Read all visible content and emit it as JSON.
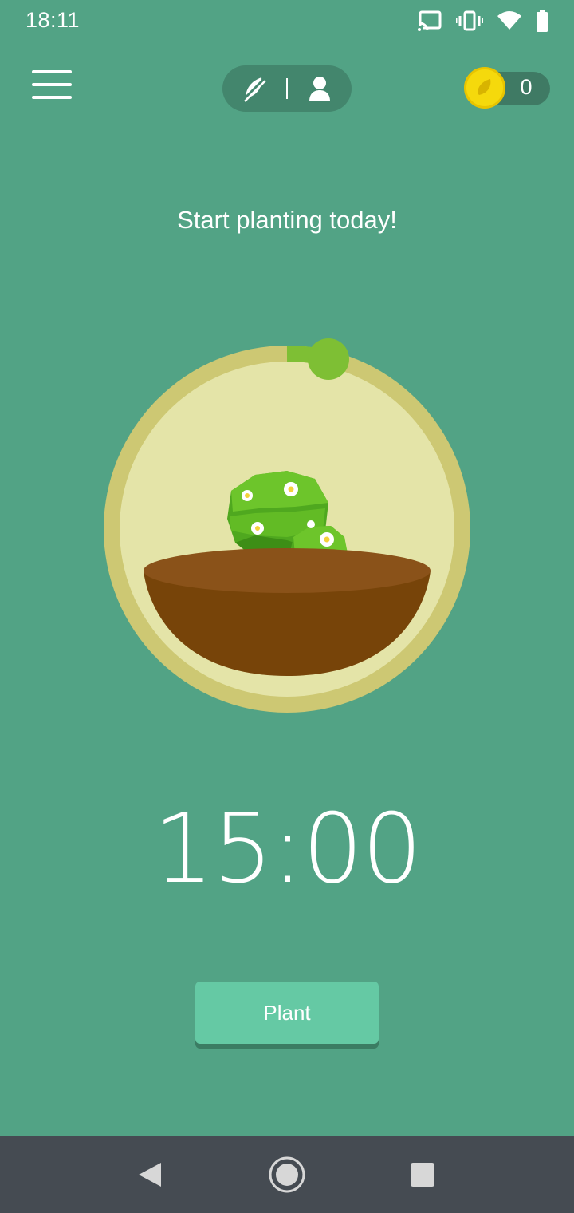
{
  "status_bar": {
    "time": "18:11",
    "icons": [
      "cast-icon",
      "vibrate-icon",
      "wifi-icon",
      "battery-icon"
    ]
  },
  "header": {
    "menu_icon": "hamburger-menu-icon",
    "mode_toggle": {
      "left_icon": "leaf-off-icon",
      "right_icon": "person-icon"
    },
    "coins": {
      "icon": "coin-icon",
      "count": "0"
    }
  },
  "main": {
    "headline": "Start planting today!",
    "timer": "15:00",
    "progress": 0.05,
    "plant_button_label": "Plant"
  },
  "nav_bar": {
    "back_icon": "back-triangle-icon",
    "home_icon": "home-circle-icon",
    "recents_icon": "recents-square-icon"
  },
  "colors": {
    "background": "#52a385",
    "ring": "#cdc873",
    "ring_inner": "#e4e4a8",
    "progress": "#7ebf34",
    "soil": "#7a4a13",
    "button": "#65c9a4",
    "coin": "#f5d90c",
    "nav_bar": "#454b52"
  }
}
